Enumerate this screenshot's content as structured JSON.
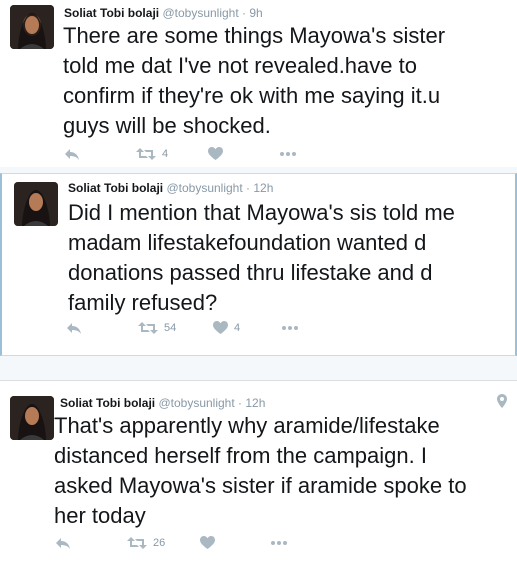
{
  "tweets": [
    {
      "name": "Soliat Tobi bolaji",
      "handle": "@tobysunlight",
      "separator": "·",
      "time": "9h",
      "text": "There are some things Mayowa's sister\ntold me dat I've not revealed.have to\nconfirm if they're ok with me saying it.u\nguys will be shocked.",
      "retweets": "4",
      "likes": ""
    },
    {
      "name": "Soliat Tobi bolaji",
      "handle": "@tobysunlight",
      "separator": "·",
      "time": "12h",
      "text": "Did I mention that Mayowa's sis told me\nmadam lifestakefoundation wanted d\ndonations passed thru lifestake and d\nfamily refused?",
      "retweets": "54",
      "likes": "4"
    },
    {
      "name": "Soliat Tobi bolaji",
      "handle": "@tobysunlight",
      "separator": "·",
      "time": "12h",
      "text": "That's apparently why aramide/lifestake\ndistanced herself from the campaign. I\nasked Mayowa's sister if aramide spoke to\nher today",
      "retweets": "26",
      "likes": ""
    }
  ],
  "icons": {
    "reply": "reply-icon",
    "retweet": "retweet-icon",
    "like": "heart-icon",
    "more": "more-icon",
    "location": "location-pin-icon"
  },
  "colors": {
    "text": "#14171a",
    "muted": "#8899a6",
    "icon": "#aab8c2",
    "background": "#f5f8fa",
    "highlight_border": "#9bbfd6"
  }
}
